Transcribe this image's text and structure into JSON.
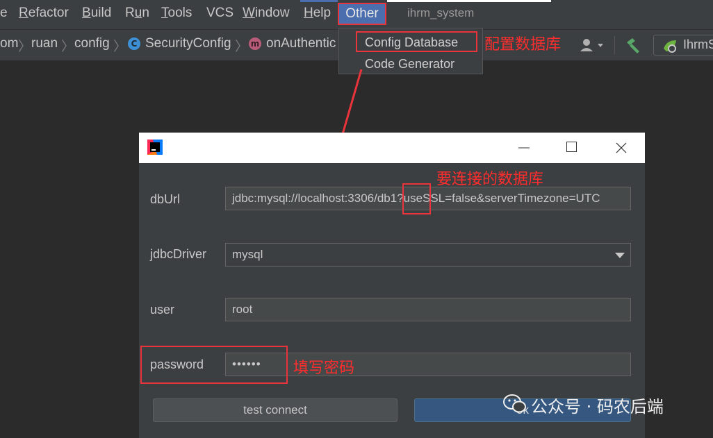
{
  "menubar": {
    "items": [
      {
        "label": "e",
        "underline_index": -1
      },
      {
        "label": "Refactor",
        "underline_index": 0
      },
      {
        "label": "Build",
        "underline_index": 0
      },
      {
        "label": "Run",
        "underline_index": 1
      },
      {
        "label": "Tools",
        "underline_index": 0
      },
      {
        "label": "VCS",
        "underline_index": -1
      },
      {
        "label": "Window",
        "underline_index": 0
      },
      {
        "label": "Help",
        "underline_index": 0
      }
    ],
    "other_label": "Other",
    "project_name": "ihrm_system"
  },
  "navbar": {
    "crumbs": [
      "om",
      "ruan",
      "config",
      "SecurityConfig",
      "onAuthentic"
    ],
    "class_badge": "C",
    "method_badge": "m",
    "run_config_label": "IhrmS"
  },
  "dropdown": {
    "items": [
      "Config Database",
      "Code Generator"
    ]
  },
  "annotations": {
    "config_db": "配置数据库",
    "target_db": "要连接的数据库",
    "fill_password": "填写密码"
  },
  "dialog": {
    "fields": {
      "dbUrl": {
        "label": "dbUrl",
        "value": "jdbc:mysql://localhost:3306/db1?useSSL=false&serverTimezone=UTC"
      },
      "jdbcDriver": {
        "label": "jdbcDriver",
        "value": "mysql"
      },
      "user": {
        "label": "user",
        "value": "root"
      },
      "password": {
        "label": "password",
        "value": "••••••"
      }
    },
    "buttons": {
      "test_connect": "test connect",
      "ok": "ok"
    }
  },
  "watermark": "公众号 · 码农后端",
  "colors": {
    "menu_bg": "#3c3f41",
    "editor_bg": "#2b2b2b",
    "selection": "#4b6eaf",
    "annotation_red": "#ff2d2d"
  }
}
